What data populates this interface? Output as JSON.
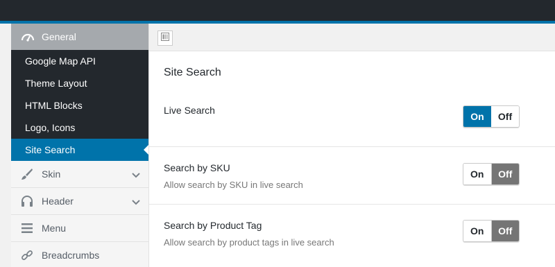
{
  "colors": {
    "accent": "#0073aa",
    "admin_dark": "#23282d",
    "toggle_off_active": "#757575"
  },
  "sidebar": {
    "general": {
      "label": "General",
      "icon": "dashboard-gauge-icon"
    },
    "sub_items": [
      {
        "label": "Google Map API"
      },
      {
        "label": "Theme Layout"
      },
      {
        "label": "HTML Blocks"
      },
      {
        "label": "Logo, Icons"
      },
      {
        "label": "Site Search",
        "active": true
      }
    ],
    "items": [
      {
        "label": "Skin",
        "icon": "brush-icon",
        "has_chevron": true
      },
      {
        "label": "Header",
        "icon": "headphones-icon",
        "has_chevron": true
      },
      {
        "label": "Menu",
        "icon": "menu-icon",
        "has_chevron": false
      },
      {
        "label": "Breadcrumbs",
        "icon": "link-icon",
        "has_chevron": false
      }
    ]
  },
  "main": {
    "section_title": "Site Search",
    "options": [
      {
        "label": "Live Search",
        "description": "",
        "on_label": "On",
        "off_label": "Off",
        "state": "on"
      },
      {
        "label": "Search by SKU",
        "description": "Allow search by SKU in live search",
        "on_label": "On",
        "off_label": "Off",
        "state": "off"
      },
      {
        "label": "Search by Product Tag",
        "description": "Allow search by product tags in live search",
        "on_label": "On",
        "off_label": "Off",
        "state": "off"
      }
    ]
  }
}
